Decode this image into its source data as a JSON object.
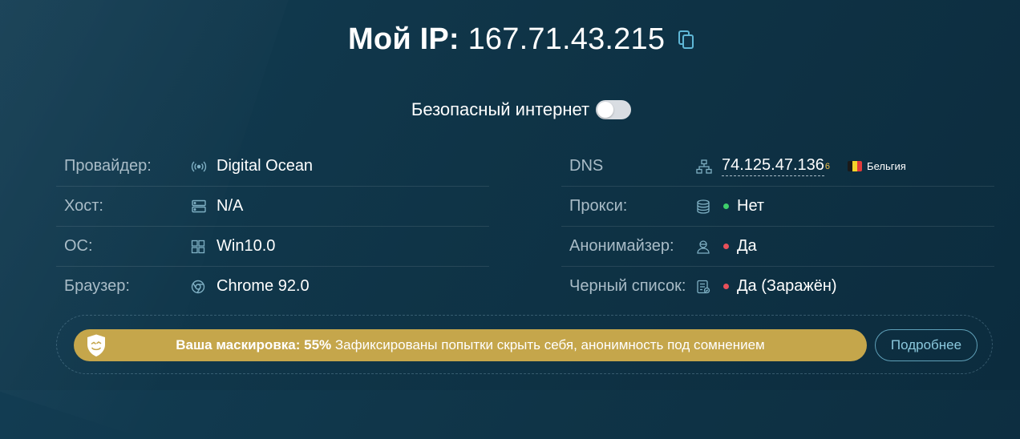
{
  "header": {
    "title_prefix": "Мой IP:",
    "ip": "167.71.43.215"
  },
  "safe_internet": {
    "label": "Безопасный интернет",
    "enabled": false
  },
  "left_rows": [
    {
      "label": "Провайдер:",
      "value": "Digital Ocean",
      "icon": "signal-icon"
    },
    {
      "label": "Хост:",
      "value": "N/A",
      "icon": "server-icon"
    },
    {
      "label": "ОС:",
      "value": "Win10.0",
      "icon": "windows-icon"
    },
    {
      "label": "Браузер:",
      "value": "Chrome 92.0",
      "icon": "chrome-icon"
    }
  ],
  "right_rows": {
    "dns": {
      "label": "DNS",
      "value": "74.125.47.136",
      "count": "6",
      "country": "Бельгия",
      "icon": "network-icon"
    },
    "proxy": {
      "label": "Прокси:",
      "value": "Нет",
      "status": "green",
      "icon": "database-icon"
    },
    "anonymizer": {
      "label": "Анонимайзер:",
      "value": "Да",
      "status": "red",
      "icon": "user-mask-icon"
    },
    "blacklist": {
      "label": "Черный список:",
      "value": "Да (Заражён)",
      "status": "red",
      "icon": "list-check-icon"
    }
  },
  "banner": {
    "bold": "Ваша маскировка: 55%",
    "text": "Зафиксированы попытки скрыть себя, анонимность под сомнением",
    "disguise_percent": 55,
    "button": "Подробнее"
  },
  "colors": {
    "gold": "#c5a64b",
    "green": "#3ecf6b",
    "red": "#e9505a",
    "accent": "#5fa0b8"
  }
}
